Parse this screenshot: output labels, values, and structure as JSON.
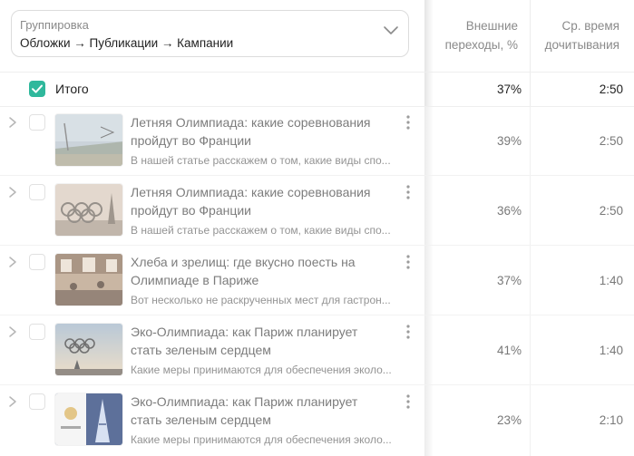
{
  "grouping": {
    "label": "Группировка",
    "value": "Обложки → Публикации → Кампании"
  },
  "columns": {
    "external_header": [
      "Внешние",
      "переходы, %"
    ],
    "time_header": [
      "Ср. время",
      "дочитывания"
    ]
  },
  "total": {
    "label": "Итого",
    "external": "37%",
    "time": "2:50"
  },
  "rows": [
    {
      "title_line1": "Летняя Олимпиада: какие соревнования",
      "title_line2": "пройдут во Франции",
      "desc": "В нашей статье расскажем о том, какие виды спо...",
      "external": "39%",
      "time": "2:50",
      "thumb_icon": "olympic-stadium-thumbnail"
    },
    {
      "title_line1": "Летняя Олимпиада: какие соревнования",
      "title_line2": "пройдут во Франции",
      "desc": "В нашей статье расскажем о том, какие виды спо...",
      "external": "36%",
      "time": "2:50",
      "thumb_icon": "olympic-rings-paris-thumbnail"
    },
    {
      "title_line1": "Хлеба и зрелищ: где вкусно поесть на",
      "title_line2": "Олимпиаде в Париже",
      "desc": "Вот несколько не раскрученных мест для гастрон...",
      "external": "37%",
      "time": "1:40",
      "thumb_icon": "restaurant-thumbnail"
    },
    {
      "title_line1": "Эко-Олимпиада: как Париж планирует",
      "title_line2": "стать зеленым сердцем",
      "desc": "Какие меры принимаются для обеспечения эколо...",
      "external": "41%",
      "time": "1:40",
      "thumb_icon": "rings-sunset-thumbnail"
    },
    {
      "title_line1": "Эко-Олимпиада: как Париж планирует",
      "title_line2": "стать зеленым сердцем",
      "desc": "Какие меры принимаются для обеспечения эколо...",
      "external": "23%",
      "time": "2:10",
      "thumb_icon": "eiffel-tower-poster-thumbnail"
    }
  ],
  "colors": {
    "accent": "#2fb89c"
  }
}
